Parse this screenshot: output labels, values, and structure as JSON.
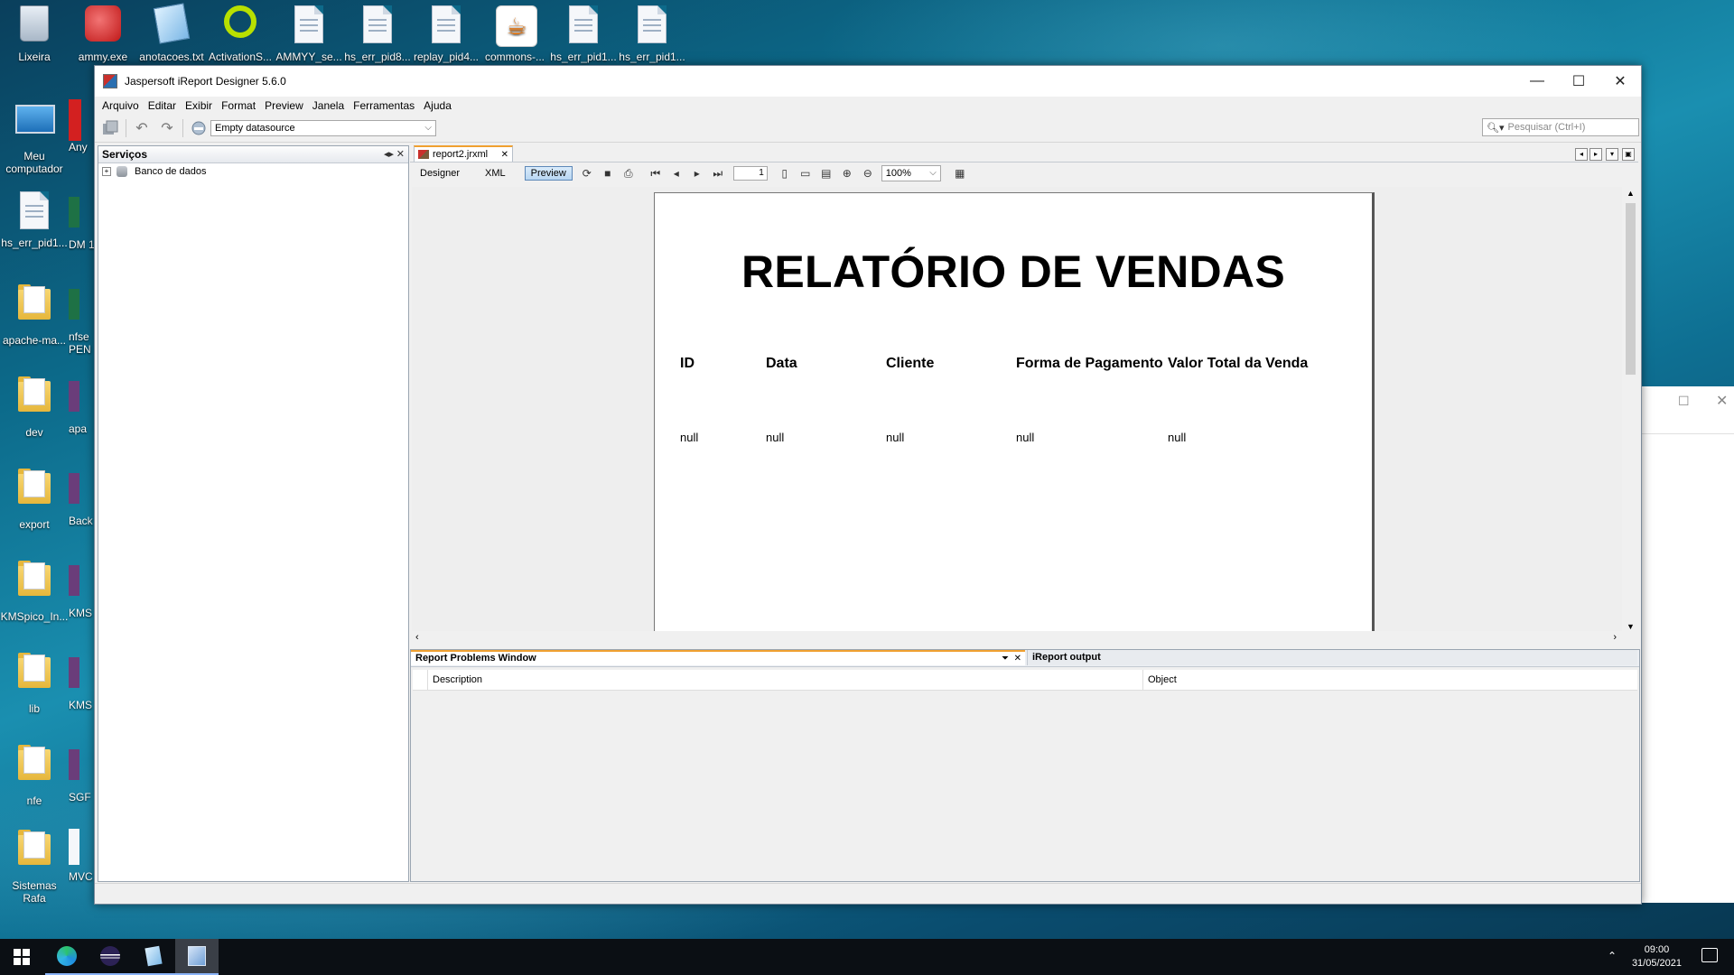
{
  "desktop": {
    "icons": [
      {
        "label": "Lixeira"
      },
      {
        "label": "ammy.exe"
      },
      {
        "label": "anotacoes.txt"
      },
      {
        "label": "ActivationS..."
      },
      {
        "label": "AMMYY_se..."
      },
      {
        "label": "hs_err_pid8..."
      },
      {
        "label": "replay_pid4..."
      },
      {
        "label": "commons-..."
      },
      {
        "label": "hs_err_pid1..."
      },
      {
        "label": "hs_err_pid1..."
      },
      {
        "label": "Meu computador"
      },
      {
        "label": "Any"
      },
      {
        "label": "hs_err_pid1..."
      },
      {
        "label": "DM 1"
      },
      {
        "label": "apache-ma..."
      },
      {
        "label": "nfse PEN"
      },
      {
        "label": "dev"
      },
      {
        "label": "apa"
      },
      {
        "label": "export"
      },
      {
        "label": "Back"
      },
      {
        "label": "KMSpico_In..."
      },
      {
        "label": "KMS"
      },
      {
        "label": "lib"
      },
      {
        "label": "KMS"
      },
      {
        "label": "nfe"
      },
      {
        "label": "SGF"
      },
      {
        "label": "Sistemas Rafa"
      },
      {
        "label": "MVC"
      }
    ]
  },
  "window": {
    "title": "Jaspersoft iReport Designer 5.6.0",
    "minimize": "—",
    "maximize": "☐",
    "close": "✕"
  },
  "menu": [
    "Arquivo",
    "Editar",
    "Exibir",
    "Format",
    "Preview",
    "Janela",
    "Ferramentas",
    "Ajuda"
  ],
  "toolbar": {
    "datasource": "Empty datasource",
    "search_placeholder": "Pesquisar (Ctrl+I)"
  },
  "services": {
    "title": "Serviços",
    "tree": [
      {
        "label": "Banco de dados"
      }
    ]
  },
  "editor": {
    "tab": "report2.jrxml",
    "views": [
      "Designer",
      "XML",
      "Preview"
    ],
    "active_view": "Preview",
    "page_number": "1",
    "zoom": "100%"
  },
  "report": {
    "title": "RELATÓRIO DE VENDAS",
    "columns": [
      "ID",
      "Data",
      "Cliente",
      "Forma de Pagamento",
      "Valor Total da Venda"
    ],
    "row": [
      "null",
      "null",
      "null",
      "null",
      "null"
    ]
  },
  "problems": {
    "tab1": "Report Problems Window",
    "tab2": "iReport output",
    "col_description": "Description",
    "col_object": "Object"
  },
  "taskbar": {
    "time": "09:00",
    "date": "31/05/2021"
  },
  "colors": {
    "accent_tab": "#f0a030",
    "preview_active": "#b8d6f2"
  }
}
